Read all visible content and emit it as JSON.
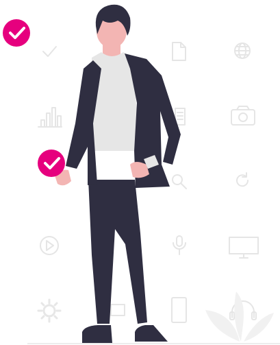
{
  "illustration": {
    "icons": [
      "checkmark-icon",
      "document-icon",
      "globe-icon",
      "bar-chart-icon",
      "camera-icon",
      "search-icon",
      "refresh-icon",
      "play-icon",
      "microphone-icon",
      "monitor-icon",
      "settings-gear-icon",
      "smartphone-icon",
      "headphones-icon"
    ],
    "badges": [
      "check-badge-top-left",
      "check-badge-hand"
    ],
    "colors": {
      "accent": "#e6007e",
      "suit": "#2f2e41",
      "shirt": "#e6e6e6",
      "skin": "#f3b5b3",
      "hair": "#2f2e41",
      "icon_gray": "#e9e9e9",
      "leaf_gray": "#f1f1f1",
      "shoe": "#2f2e41",
      "background": "#ffffff"
    }
  }
}
